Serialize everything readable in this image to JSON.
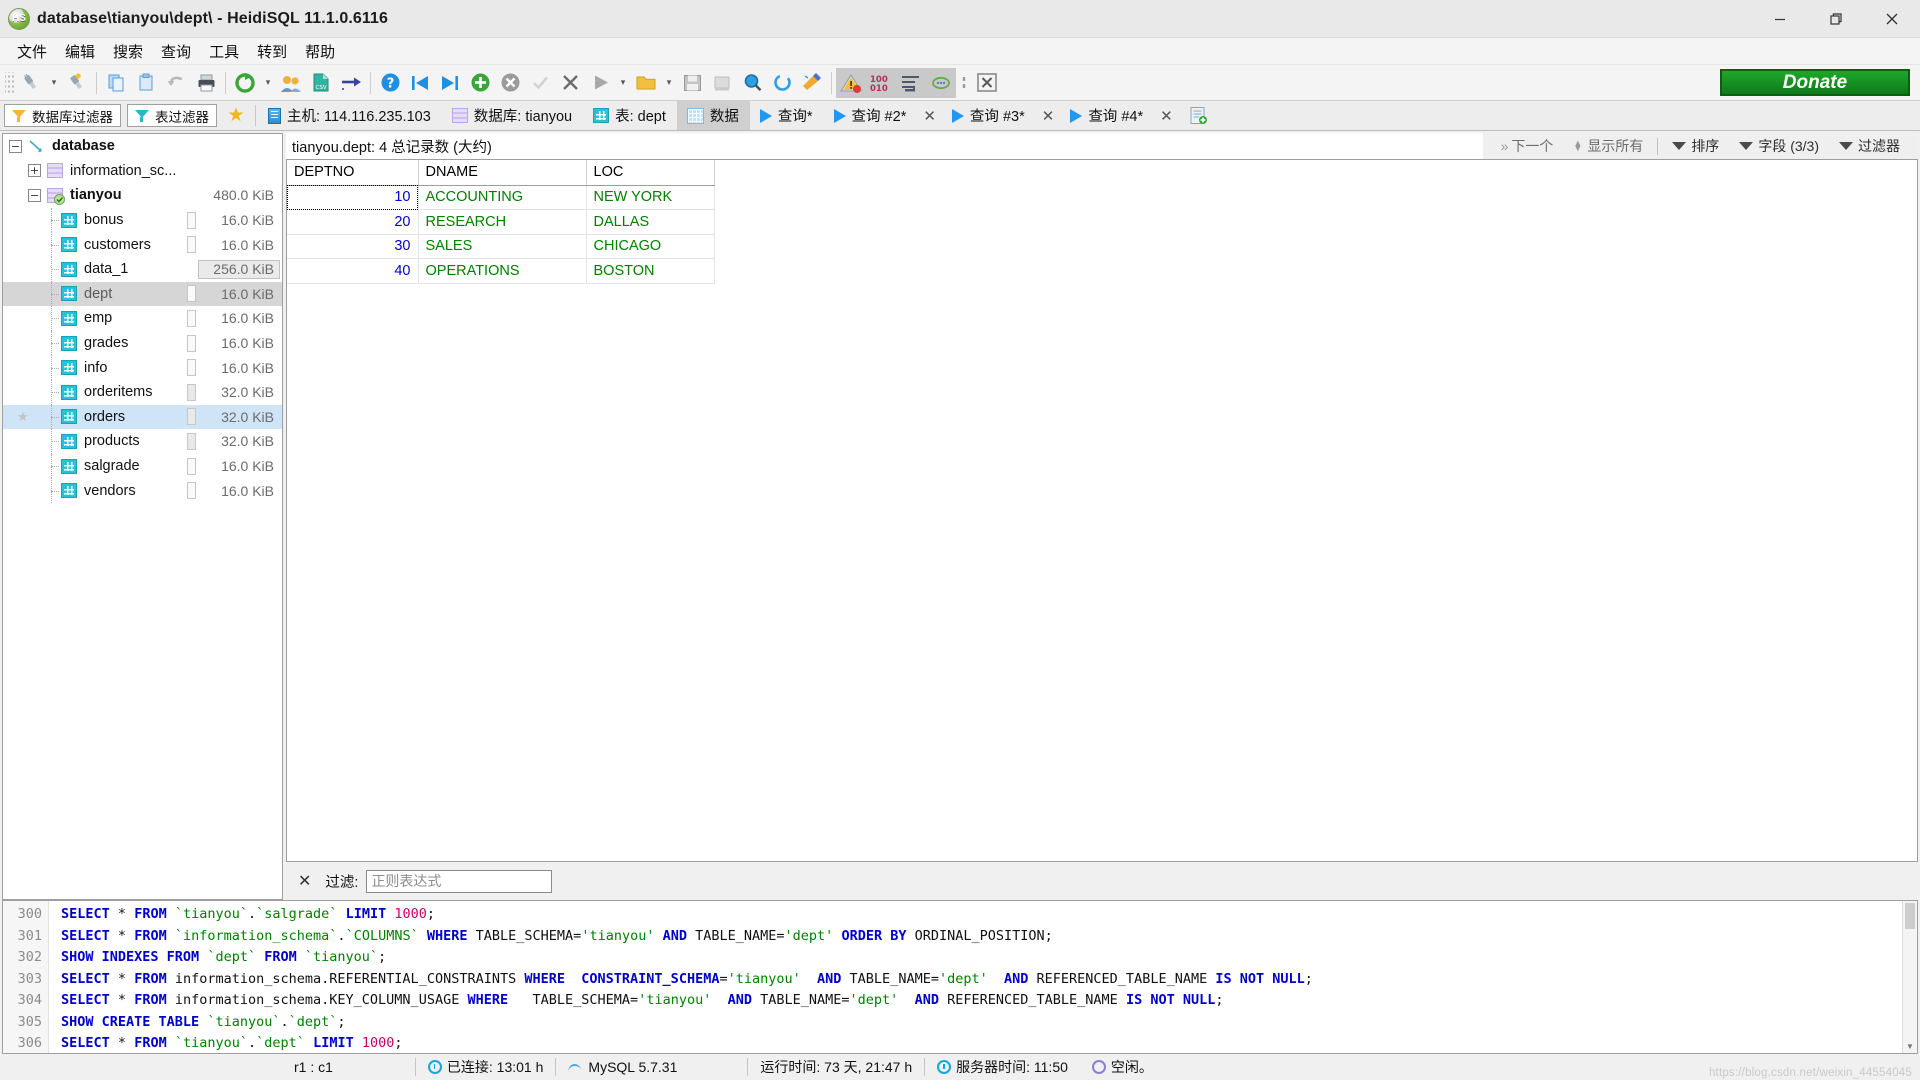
{
  "window": {
    "title": "database\\tianyou\\dept\\ - HeidiSQL 11.1.0.6116",
    "app_badge": "HS",
    "minimize_label": "Minimize",
    "restore_label": "Restore",
    "close_label": "Close"
  },
  "menu": {
    "items": [
      "文件",
      "编辑",
      "搜索",
      "查询",
      "工具",
      "转到",
      "帮助"
    ]
  },
  "toolbar": {
    "icons": [
      "session-manager-icon",
      "session-dropdown-icon",
      "disconnect-icon",
      "copy-icon",
      "paste-icon",
      "undo-icon",
      "print-icon",
      "refresh-icon",
      "refresh-dropdown-icon",
      "users-icon",
      "export-csv-icon",
      "import-icon",
      "help-icon",
      "first-icon",
      "last-icon",
      "insert-row-icon",
      "delete-row-icon",
      "apply-icon",
      "cancel-icon",
      "execute-icon",
      "execute-dropdown-icon",
      "open-folder-icon",
      "open-dropdown-icon",
      "save-icon",
      "save-as-icon",
      "find-icon",
      "refresh-query-icon",
      "clear-icon",
      "warning-icon",
      "binary-icon",
      "format-sql-icon",
      "comment-icon",
      "more-icon",
      "close-tab-icon"
    ],
    "donate_label": "Donate"
  },
  "tabstrip": {
    "db_filter_label": "数据库过滤器",
    "table_filter_label": "表过滤器",
    "favorite_icon": "star-icon",
    "tabs": [
      {
        "label": "主机: 114.116.235.103",
        "icon": "server-icon",
        "active": false,
        "closable": false
      },
      {
        "label": "数据库: tianyou",
        "icon": "database-icon",
        "active": false,
        "closable": false
      },
      {
        "label": "表: dept",
        "icon": "table-icon",
        "active": false,
        "closable": false
      },
      {
        "label": "数据",
        "icon": "grid-icon",
        "active": true,
        "closable": false
      },
      {
        "label": "查询*",
        "icon": "play-icon",
        "active": false,
        "closable": false
      },
      {
        "label": "查询 #2*",
        "icon": "play-icon",
        "active": false,
        "closable": true
      },
      {
        "label": "查询 #3*",
        "icon": "play-icon",
        "active": false,
        "closable": true
      },
      {
        "label": "查询 #4*",
        "icon": "play-icon",
        "active": false,
        "closable": true
      }
    ],
    "new_query_tab_icon": "new-query-icon"
  },
  "sidebar": {
    "nodes": [
      {
        "label": "database",
        "level": 0,
        "icon": "connection-icon",
        "expander": "−",
        "size": "",
        "bold": true,
        "state": ""
      },
      {
        "label": "information_sc...",
        "level": 1,
        "icon": "database-icon",
        "expander": "+",
        "size": "",
        "bold": false,
        "state": ""
      },
      {
        "label": "tianyou",
        "level": 1,
        "icon": "database-active-icon",
        "expander": "−",
        "size": "480.0 KiB",
        "bold": true,
        "state": ""
      },
      {
        "label": "bonus",
        "level": 2,
        "icon": "table-icon",
        "expander": "",
        "size": "16.0 KiB",
        "bold": false,
        "state": ""
      },
      {
        "label": "customers",
        "level": 2,
        "icon": "table-icon",
        "expander": "",
        "size": "16.0 KiB",
        "bold": false,
        "state": ""
      },
      {
        "label": "data_1",
        "level": 2,
        "icon": "table-icon",
        "expander": "",
        "size": "256.0 KiB",
        "bold": false,
        "state": ""
      },
      {
        "label": "dept",
        "level": 2,
        "icon": "table-icon",
        "expander": "",
        "size": "16.0 KiB",
        "bold": false,
        "state": "selected"
      },
      {
        "label": "emp",
        "level": 2,
        "icon": "table-icon",
        "expander": "",
        "size": "16.0 KiB",
        "bold": false,
        "state": ""
      },
      {
        "label": "grades",
        "level": 2,
        "icon": "table-icon",
        "expander": "",
        "size": "16.0 KiB",
        "bold": false,
        "state": ""
      },
      {
        "label": "info",
        "level": 2,
        "icon": "table-icon",
        "expander": "",
        "size": "16.0 KiB",
        "bold": false,
        "state": ""
      },
      {
        "label": "orderitems",
        "level": 2,
        "icon": "table-icon",
        "expander": "",
        "size": "32.0 KiB",
        "bold": false,
        "state": ""
      },
      {
        "label": "orders",
        "level": 2,
        "icon": "table-icon",
        "expander": "",
        "size": "32.0 KiB",
        "bold": false,
        "state": "hover"
      },
      {
        "label": "products",
        "level": 2,
        "icon": "table-icon",
        "expander": "",
        "size": "32.0 KiB",
        "bold": false,
        "state": ""
      },
      {
        "label": "salgrade",
        "level": 2,
        "icon": "table-icon",
        "expander": "",
        "size": "16.0 KiB",
        "bold": false,
        "state": ""
      },
      {
        "label": "vendors",
        "level": 2,
        "icon": "table-icon",
        "expander": "",
        "size": "16.0 KiB",
        "bold": false,
        "state": ""
      }
    ]
  },
  "grid_toolbar": {
    "title": "tianyou.dept: 4 总记录数 (大约)",
    "next_label": "下一个",
    "show_all_label": "显示所有",
    "sort_label": "排序",
    "columns_label": "字段 (3/3)",
    "filter_label": "过滤器"
  },
  "chart_data": {
    "type": "table",
    "title": "tianyou.dept",
    "columns": [
      "DEPTNO",
      "DNAME",
      "LOC"
    ],
    "rows": [
      [
        "10",
        "ACCOUNTING",
        "NEW YORK"
      ],
      [
        "20",
        "RESEARCH",
        "DALLAS"
      ],
      [
        "30",
        "SALES",
        "CHICAGO"
      ],
      [
        "40",
        "OPERATIONS",
        "BOSTON"
      ]
    ],
    "row_count": 4,
    "focused_cell": [
      0,
      0
    ],
    "colors": {
      "numeric": "#0000d0",
      "text": "#008000"
    }
  },
  "filter_bar": {
    "close_icon": "close-icon",
    "label": "过滤:",
    "input_value": "",
    "input_placeholder": "正则表达式"
  },
  "sql_log": {
    "lines": [
      {
        "no": "300",
        "sql": "SELECT * FROM `tianyou`.`salgrade` LIMIT 1000;"
      },
      {
        "no": "301",
        "sql": "SELECT * FROM `information_schema`.`COLUMNS` WHERE TABLE_SCHEMA='tianyou' AND TABLE_NAME='dept' ORDER BY ORDINAL_POSITION;"
      },
      {
        "no": "302",
        "sql": "SHOW INDEXES FROM `dept` FROM `tianyou`;"
      },
      {
        "no": "303",
        "sql": "SELECT * FROM information_schema.REFERENTIAL_CONSTRAINTS WHERE   CONSTRAINT_SCHEMA='tianyou'   AND TABLE_NAME='dept'   AND REFERENCED_TABLE_NAME IS NOT NULL;"
      },
      {
        "no": "304",
        "sql": "SELECT * FROM information_schema.KEY_COLUMN_USAGE WHERE    TABLE_SCHEMA='tianyou'   AND TABLE_NAME='dept'   AND REFERENCED_TABLE_NAME IS NOT NULL;"
      },
      {
        "no": "305",
        "sql": "SHOW CREATE TABLE `tianyou`.`dept`;"
      },
      {
        "no": "306",
        "sql": "SELECT * FROM `tianyou`.`dept` LIMIT 1000;"
      }
    ]
  },
  "status_bar": {
    "cursor": "r1 : c1",
    "connected_label": "已连接: 13:01 h",
    "server_version": "MySQL 5.7.31",
    "uptime_label": "运行时间: 73 天, 21:47 h",
    "server_time_label": "服务器时间: 11:50",
    "idle_label": "空闲。",
    "watermark": "https://blog.csdn.net/weixin_44554045"
  }
}
